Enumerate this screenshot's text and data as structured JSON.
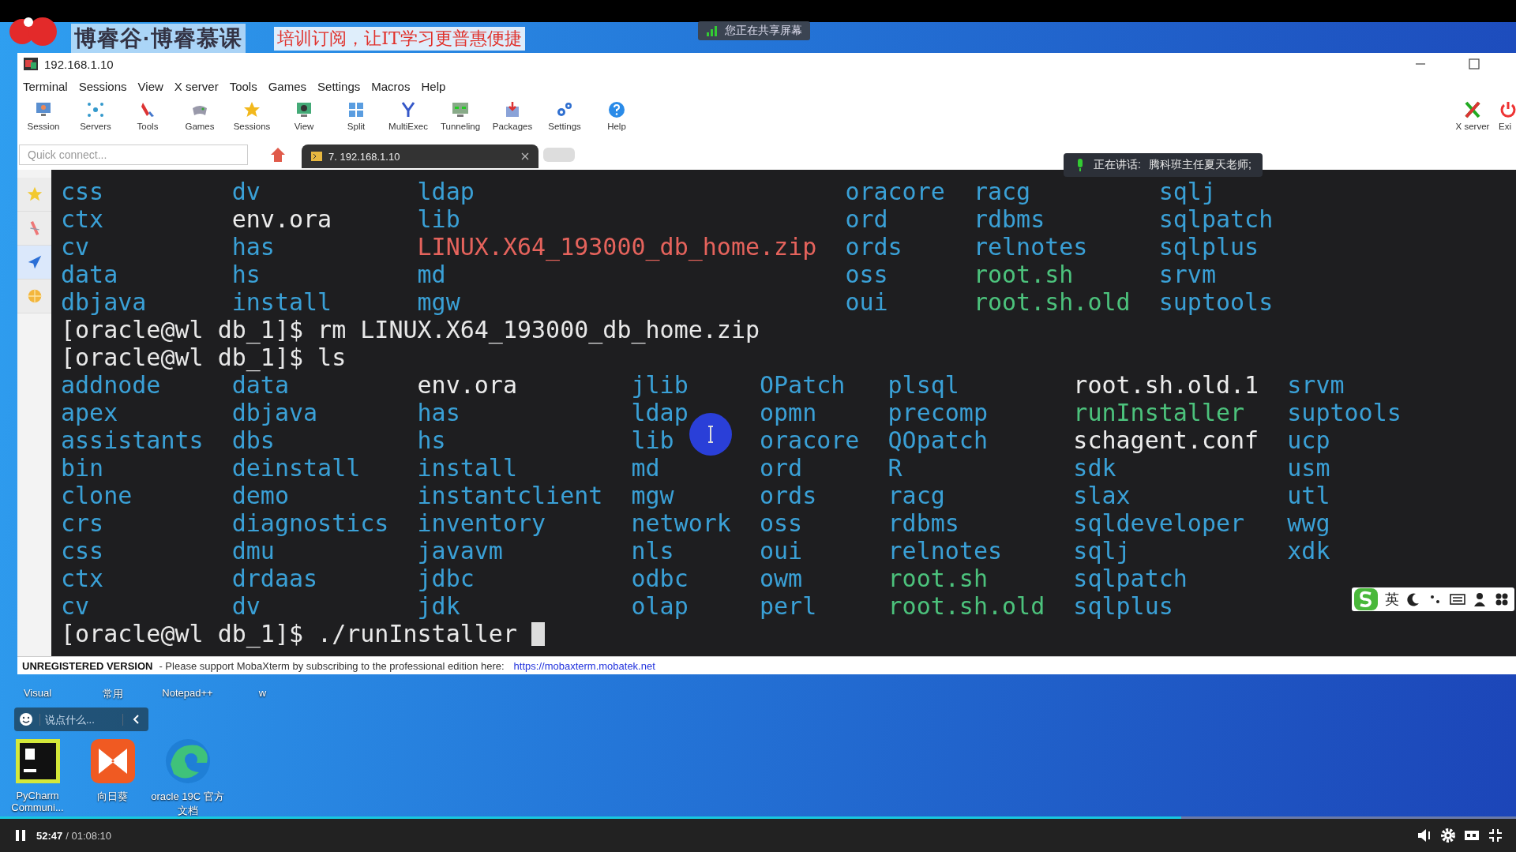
{
  "top_bar": {
    "brand": "博睿谷·博睿慕课",
    "slogan": "培训订阅，让IT学习更普惠便捷",
    "sharing_notice": "您正在共享屏幕"
  },
  "window": {
    "title": "192.168.1.10"
  },
  "menu": [
    "Terminal",
    "Sessions",
    "View",
    "X server",
    "Tools",
    "Games",
    "Settings",
    "Macros",
    "Help"
  ],
  "toolbar": [
    {
      "label": "Session"
    },
    {
      "label": "Servers"
    },
    {
      "label": "Tools"
    },
    {
      "label": "Games"
    },
    {
      "label": "Sessions"
    },
    {
      "label": "View"
    },
    {
      "label": "Split"
    },
    {
      "label": "MultiExec"
    },
    {
      "label": "Tunneling"
    },
    {
      "label": "Packages"
    },
    {
      "label": "Settings"
    },
    {
      "label": "Help"
    }
  ],
  "toolbar_right": [
    {
      "label": "X server"
    },
    {
      "label": "Exi"
    }
  ],
  "quick_connect": {
    "placeholder": "Quick connect..."
  },
  "tabs": [
    {
      "label": "7. 192.168.1.10",
      "selected": true
    }
  ],
  "speaking_notice": {
    "label": "正在讲话:",
    "speaker": "腾科班主任夏天老师;"
  },
  "terminal": {
    "lines": [
      {
        "kind": "listing",
        "rows": [
          [
            {
              "text": "css",
              "color": "#3aa0d6"
            },
            {
              "text": "dv",
              "color": "#3aa0d6"
            },
            {
              "text": "ldap",
              "color": "#3aa0d6"
            },
            {
              "text": "oracore",
              "color": "#3aa0d6"
            },
            {
              "text": "racg",
              "color": "#3aa0d6"
            },
            {
              "text": "sqlj",
              "color": "#3aa0d6"
            }
          ],
          [
            {
              "text": "ctx",
              "color": "#3aa0d6"
            },
            {
              "text": "env.ora",
              "color": "#ececec"
            },
            {
              "text": "lib",
              "color": "#3aa0d6"
            },
            {
              "text": "ord",
              "color": "#3aa0d6"
            },
            {
              "text": "rdbms",
              "color": "#3aa0d6"
            },
            {
              "text": "sqlpatch",
              "color": "#3aa0d6"
            }
          ],
          [
            {
              "text": "cv",
              "color": "#3aa0d6"
            },
            {
              "text": "has",
              "color": "#3aa0d6"
            },
            {
              "text": "LINUX.X64_193000_db_home.zip",
              "color": "#e5635c"
            },
            {
              "text": "ords",
              "color": "#3aa0d6"
            },
            {
              "text": "relnotes",
              "color": "#3aa0d6"
            },
            {
              "text": "sqlplus",
              "color": "#3aa0d6"
            }
          ],
          [
            {
              "text": "data",
              "color": "#3aa0d6"
            },
            {
              "text": "hs",
              "color": "#3aa0d6"
            },
            {
              "text": "md",
              "color": "#3aa0d6"
            },
            {
              "text": "oss",
              "color": "#3aa0d6"
            },
            {
              "text": "root.sh",
              "color": "#4cc27c"
            },
            {
              "text": "srvm",
              "color": "#3aa0d6"
            }
          ],
          [
            {
              "text": "dbjava",
              "color": "#3aa0d6"
            },
            {
              "text": "install",
              "color": "#3aa0d6"
            },
            {
              "text": "mgw",
              "color": "#3aa0d6"
            },
            {
              "text": "oui",
              "color": "#3aa0d6"
            },
            {
              "text": "root.sh.old",
              "color": "#4cc27c"
            },
            {
              "text": "suptools",
              "color": "#3aa0d6"
            }
          ]
        ]
      },
      {
        "kind": "prompt",
        "prompt": "[oracle@wl db_1]$",
        "command": "rm LINUX.X64_193000_db_home.zip",
        "cursor": false
      },
      {
        "kind": "prompt",
        "prompt": "[oracle@wl db_1]$",
        "command": "ls",
        "cursor": false
      },
      {
        "kind": "listing",
        "rows": [
          [
            {
              "text": "addnode",
              "color": "#3aa0d6"
            },
            {
              "text": "data",
              "color": "#3aa0d6"
            },
            {
              "text": "env.ora",
              "color": "#ececec"
            },
            {
              "text": "jlib",
              "color": "#3aa0d6"
            },
            {
              "text": "OPatch",
              "color": "#3aa0d6"
            },
            {
              "text": "plsql",
              "color": "#3aa0d6"
            },
            {
              "text": "root.sh.old.1",
              "color": "#ececec"
            },
            {
              "text": "srvm",
              "color": "#3aa0d6"
            }
          ],
          [
            {
              "text": "apex",
              "color": "#3aa0d6"
            },
            {
              "text": "dbjava",
              "color": "#3aa0d6"
            },
            {
              "text": "has",
              "color": "#3aa0d6"
            },
            {
              "text": "ldap",
              "color": "#3aa0d6"
            },
            {
              "text": "opmn",
              "color": "#3aa0d6"
            },
            {
              "text": "precomp",
              "color": "#3aa0d6"
            },
            {
              "text": "runInstaller",
              "color": "#4cc27c"
            },
            {
              "text": "suptools",
              "color": "#3aa0d6"
            }
          ],
          [
            {
              "text": "assistants",
              "color": "#3aa0d6"
            },
            {
              "text": "dbs",
              "color": "#3aa0d6"
            },
            {
              "text": "hs",
              "color": "#3aa0d6"
            },
            {
              "text": "lib",
              "color": "#3aa0d6"
            },
            {
              "text": "oracore",
              "color": "#3aa0d6"
            },
            {
              "text": "QOpatch",
              "color": "#3aa0d6"
            },
            {
              "text": "schagent.conf",
              "color": "#ececec"
            },
            {
              "text": "ucp",
              "color": "#3aa0d6"
            }
          ],
          [
            {
              "text": "bin",
              "color": "#3aa0d6"
            },
            {
              "text": "deinstall",
              "color": "#3aa0d6"
            },
            {
              "text": "install",
              "color": "#3aa0d6"
            },
            {
              "text": "md",
              "color": "#3aa0d6"
            },
            {
              "text": "ord",
              "color": "#3aa0d6"
            },
            {
              "text": "R",
              "color": "#3aa0d6"
            },
            {
              "text": "sdk",
              "color": "#3aa0d6"
            },
            {
              "text": "usm",
              "color": "#3aa0d6"
            }
          ],
          [
            {
              "text": "clone",
              "color": "#3aa0d6"
            },
            {
              "text": "demo",
              "color": "#3aa0d6"
            },
            {
              "text": "instantclient",
              "color": "#3aa0d6"
            },
            {
              "text": "mgw",
              "color": "#3aa0d6"
            },
            {
              "text": "ords",
              "color": "#3aa0d6"
            },
            {
              "text": "racg",
              "color": "#3aa0d6"
            },
            {
              "text": "slax",
              "color": "#3aa0d6"
            },
            {
              "text": "utl",
              "color": "#3aa0d6"
            }
          ],
          [
            {
              "text": "crs",
              "color": "#3aa0d6"
            },
            {
              "text": "diagnostics",
              "color": "#3aa0d6"
            },
            {
              "text": "inventory",
              "color": "#3aa0d6"
            },
            {
              "text": "network",
              "color": "#3aa0d6"
            },
            {
              "text": "oss",
              "color": "#3aa0d6"
            },
            {
              "text": "rdbms",
              "color": "#3aa0d6"
            },
            {
              "text": "sqldeveloper",
              "color": "#3aa0d6"
            },
            {
              "text": "wwg",
              "color": "#3aa0d6"
            }
          ],
          [
            {
              "text": "css",
              "color": "#3aa0d6"
            },
            {
              "text": "dmu",
              "color": "#3aa0d6"
            },
            {
              "text": "javavm",
              "color": "#3aa0d6"
            },
            {
              "text": "nls",
              "color": "#3aa0d6"
            },
            {
              "text": "oui",
              "color": "#3aa0d6"
            },
            {
              "text": "relnotes",
              "color": "#3aa0d6"
            },
            {
              "text": "sqlj",
              "color": "#3aa0d6"
            },
            {
              "text": "xdk",
              "color": "#3aa0d6"
            }
          ],
          [
            {
              "text": "ctx",
              "color": "#3aa0d6"
            },
            {
              "text": "drdaas",
              "color": "#3aa0d6"
            },
            {
              "text": "jdbc",
              "color": "#3aa0d6"
            },
            {
              "text": "odbc",
              "color": "#3aa0d6"
            },
            {
              "text": "owm",
              "color": "#3aa0d6"
            },
            {
              "text": "root.sh",
              "color": "#4cc27c"
            },
            {
              "text": "sqlpatch",
              "color": "#3aa0d6"
            }
          ],
          [
            {
              "text": "cv",
              "color": "#3aa0d6"
            },
            {
              "text": "dv",
              "color": "#3aa0d6"
            },
            {
              "text": "jdk",
              "color": "#3aa0d6"
            },
            {
              "text": "olap",
              "color": "#3aa0d6"
            },
            {
              "text": "perl",
              "color": "#3aa0d6"
            },
            {
              "text": "root.sh.old",
              "color": "#4cc27c"
            },
            {
              "text": "sqlplus",
              "color": "#3aa0d6"
            }
          ]
        ]
      },
      {
        "kind": "prompt",
        "prompt": "[oracle@wl db_1]$",
        "command": "./runInstaller",
        "cursor": true
      }
    ]
  },
  "ime_bar": {
    "label": "英"
  },
  "status_bar": {
    "notice": "UNREGISTERED VERSION",
    "message": "-  Please support MobaXterm by subscribing to the professional edition here:",
    "link": "https://mobaxterm.mobatek.net"
  },
  "desktop": {
    "top_labels": [
      "Visual",
      "常用",
      "Notepad++",
      "w"
    ],
    "chat": {
      "placeholder": "说点什么..."
    },
    "icons": [
      {
        "label": "PyCharm Communi..."
      },
      {
        "label": "向日葵"
      },
      {
        "label": "oracle 19C 官方文档"
      }
    ]
  },
  "player": {
    "level": 0.779,
    "elapsed": "52:47",
    "duration": "/ 01:08:10"
  }
}
